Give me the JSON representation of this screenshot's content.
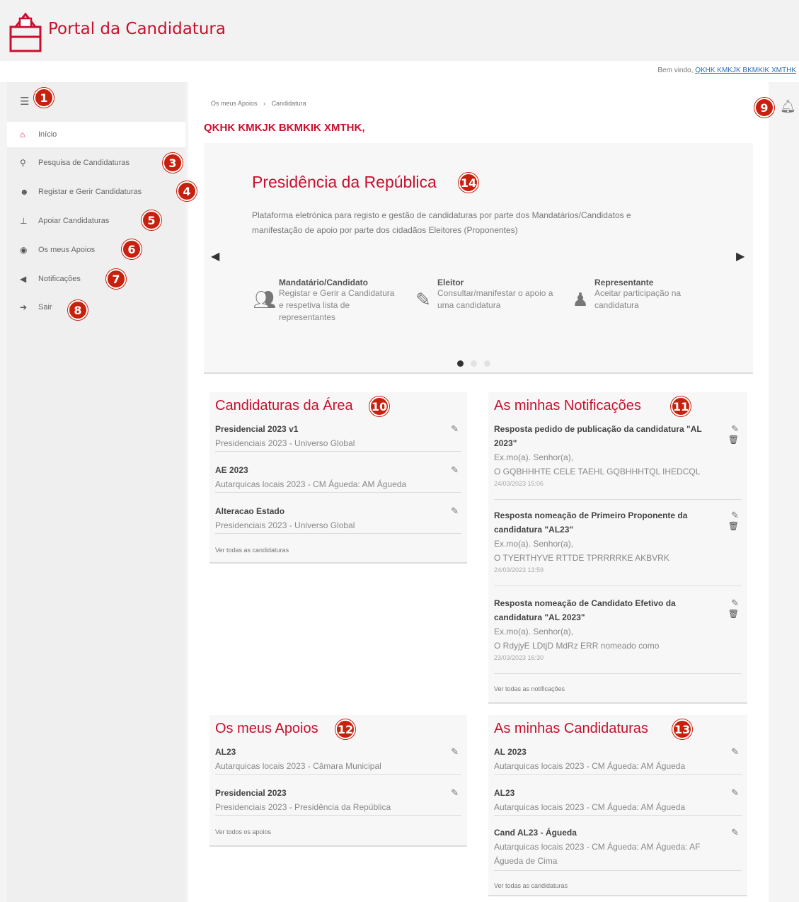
{
  "app": {
    "title": "Portal da Candidatura",
    "welcome_prefix": "Bem vindo,",
    "welcome_user": "QKHK KMKJK BKMKIK XMTHK"
  },
  "sidebar": {
    "items": [
      {
        "label": "Início",
        "icon": "home-icon"
      },
      {
        "label": "Pesquisa de Candidaturas",
        "icon": "search-icon"
      },
      {
        "label": "Registar e Gerir Candidaturas",
        "icon": "user-plus-icon"
      },
      {
        "label": "Apoiar Candidaturas",
        "icon": "vote-icon"
      },
      {
        "label": "Os meus Apoios",
        "icon": "eye-icon"
      },
      {
        "label": "Notificações",
        "icon": "megaphone-icon"
      },
      {
        "label": "Sair",
        "icon": "sign-out-icon"
      }
    ]
  },
  "badges": [
    "1",
    "3",
    "4",
    "5",
    "6",
    "7",
    "8",
    "9",
    "10",
    "11",
    "12",
    "13",
    "14"
  ],
  "breadcrumb": {
    "parent": "Os meus Apoios",
    "sep": "›",
    "current": "Candidatura"
  },
  "user_heading": "QKHK KMKJK BKMKIK XMTHK,",
  "carousel": {
    "title": "Presidência da República",
    "description": "Plataforma eletrónica para registo e gestão de candidaturas por parte dos Mandatários/Candidatos e manifestação de apoio por parte dos cidadãos Eleitores (Proponentes)",
    "roles": [
      {
        "title": "Mandatário/Candidato",
        "desc": "Registar e Gerir a Candidatura e respetiva lista de representantes"
      },
      {
        "title": "Eleitor",
        "desc": "Consultar/manifestar o apoio a uma candidatura"
      },
      {
        "title": "Representante",
        "desc": "Aceitar participação na candidatura"
      }
    ],
    "active_slide": 1,
    "slide_count": 3
  },
  "cards": {
    "area": {
      "title": "Candidaturas da Área",
      "items": [
        {
          "title": "Presidencial 2023 v1",
          "sub": "Presidenciais 2023 - Universo Global"
        },
        {
          "title": "AE 2023",
          "sub": "Autarquicas locais 2023 - CM Águeda: AM Águeda"
        },
        {
          "title": "Alteracao Estado",
          "sub": "Presidenciais 2023 - Universo Global"
        }
      ],
      "see_all": "Ver todas as candidaturas"
    },
    "notifications": {
      "title": "As minhas Notificações",
      "items": [
        {
          "title": "Resposta pedido de publicação da candidatura \"AL 2023\"",
          "greeting": "Ex.mo(a). Senhor(a),",
          "body": "O GQBHHHTE CELE TAEHL GQBHHHTQL IHEDCQL",
          "date": "24/03/2023 15:06"
        },
        {
          "title": "Resposta nomeação de Primeiro Proponente da candidatura \"AL23\"",
          "greeting": "Ex.mo(a). Senhor(a),",
          "body": "O TYERTHYVE RTTDE TPRRRRKE AKBVRK",
          "date": "24/03/2023 13:59"
        },
        {
          "title": "Resposta nomeação de Candidato Efetivo da candidatura \"AL 2023\"",
          "greeting": "Ex.mo(a). Senhor(a),",
          "body": "O RdyjyE LDtjD MdRz ERR nomeado como",
          "date": "23/03/2023 16:30"
        }
      ],
      "see_all": "Ver todas as notificações"
    },
    "supports": {
      "title": "Os meus Apoios",
      "items": [
        {
          "title": "AL23",
          "sub": "Autarquicas locais 2023 - Câmara Municipal"
        },
        {
          "title": "Presidencial 2023",
          "sub": "Presidenciais 2023 - Presidência da República"
        }
      ],
      "see_all": "Ver todos os apoios"
    },
    "my_candidacies": {
      "title": "As minhas Candidaturas",
      "items": [
        {
          "title": "AL 2023",
          "sub": "Autarquicas locais 2023 - CM Águeda: AM Águeda"
        },
        {
          "title": "AL23",
          "sub": "Autarquicas locais 2023 - CM Águeda: AM Águeda"
        },
        {
          "title": "Cand AL23 - Águeda",
          "sub": "Autarquicas locais 2023 - CM Águeda: AM Águeda: AF Águeda de Cima"
        }
      ],
      "see_all": "Ver todas as candidaturas"
    }
  },
  "colors": {
    "brand": "#c8102e",
    "badge": "#c8200e"
  }
}
